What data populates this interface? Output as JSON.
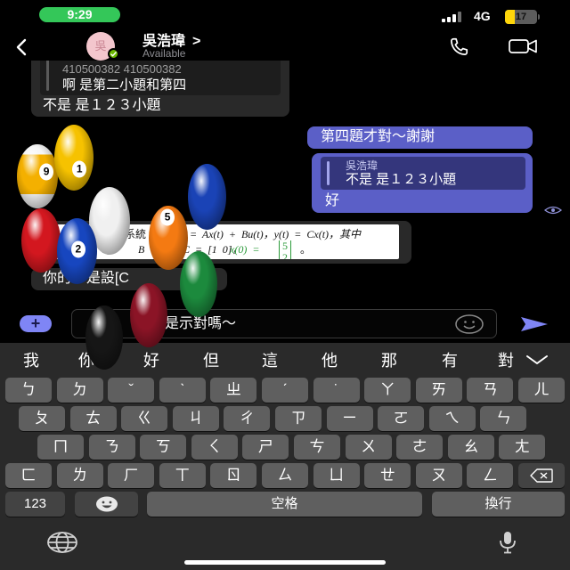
{
  "status_bar": {
    "time": "9:29",
    "network": "4G",
    "battery_level": "17",
    "signal_icon": "cellular-signal-icon",
    "battery_icon": "battery-icon"
  },
  "header": {
    "back_icon": "chevron-left-icon",
    "avatar_text": "吳",
    "presence_badge_icon": "available-check-icon",
    "contact_name": "吳浩瑋",
    "name_chevron": ">",
    "presence": "Available",
    "call_icon": "phone-icon",
    "video_call_icon": "video-camera-icon"
  },
  "messages": {
    "m1": {
      "quote_author": "410500382 410500382",
      "quote_text": "啊 是第二小題和第四",
      "text": "不是 是１２３小題"
    },
    "m2": {
      "text": "第四題才對～謝謝"
    },
    "m3": {
      "quote_author": "吳浩瑋",
      "quote_text": "不是 是１２３小題",
      "text": "好"
    },
    "read_receipt_icon": "seen-eye-icon",
    "m4": {
      "image": {
        "l1a": "系統",
        "l1b": "= Ax(t) + Bu(t)，y(t) = Cx(t)，其中",
        "l2a": "1]",
        "l2b": "B",
        "l2c": "C = [1   0]，",
        "l2d": "x(0) =",
        "m_top": "5",
        "m_bottom": "2",
        "l2e": "。"
      }
    },
    "m5": {
      "text": "你的 x 是設[C"
    }
  },
  "effect": {
    "balls": [
      {
        "number": "9",
        "color": "#f4b000",
        "stripe": true
      },
      {
        "number": "1",
        "color": "#f6c200"
      },
      {
        "color": "#f0f0f0"
      },
      {
        "color": "#d3171f"
      },
      {
        "number": "2",
        "color": "#1746bf"
      },
      {
        "number": "5",
        "color": "#f47a12"
      },
      {
        "color": "#1a43b6"
      },
      {
        "color": "#1c8a3d"
      },
      {
        "color": "#8b1426"
      },
      {
        "color": "#161616"
      }
    ]
  },
  "composer": {
    "add_icon": "plus-icon",
    "add_label": "+",
    "input_value": "是示對嗎～",
    "emoji_icon": "smiley-icon",
    "send_icon": "send-icon"
  },
  "keyboard": {
    "suggestions": [
      "我",
      "你",
      "好",
      "但",
      "這",
      "他",
      "那",
      "有",
      "對"
    ],
    "collapse_icon": "chevron-down-icon",
    "rows": [
      [
        "ㄅ",
        "ㄉ",
        "ˇ",
        "ˋ",
        "ㄓ",
        "ˊ",
        "˙",
        "ㄚ",
        "ㄞ",
        "ㄢ",
        "ㄦ"
      ],
      [
        "ㄆ",
        "ㄊ",
        "ㄍ",
        "ㄐ",
        "ㄔ",
        "ㄗ",
        "ㄧ",
        "ㄛ",
        "ㄟ",
        "ㄣ"
      ],
      [
        "ㄇ",
        "ㄋ",
        "ㄎ",
        "ㄑ",
        "ㄕ",
        "ㄘ",
        "ㄨ",
        "ㄜ",
        "ㄠ",
        "ㄤ"
      ],
      [
        "ㄈ",
        "ㄌ",
        "ㄏ",
        "ㄒ",
        "ㄖ",
        "ㄙ",
        "ㄩ",
        "ㄝ",
        "ㄡ",
        "ㄥ"
      ]
    ],
    "delete_icon": "delete-backward-icon",
    "numbers_label": "123",
    "emoji_key_icon": "emoji-face-icon",
    "space_label": "空格",
    "return_label": "換行",
    "globe_icon": "globe-icon",
    "mic_icon": "microphone-icon"
  },
  "colors": {
    "accent": "#5b5fc7",
    "accent_light": "#7f85f5",
    "presence_available": "#6bb700",
    "time_pill": "#34c759",
    "battery": "#ffd60a",
    "formula_green": "#2b9a3a"
  }
}
